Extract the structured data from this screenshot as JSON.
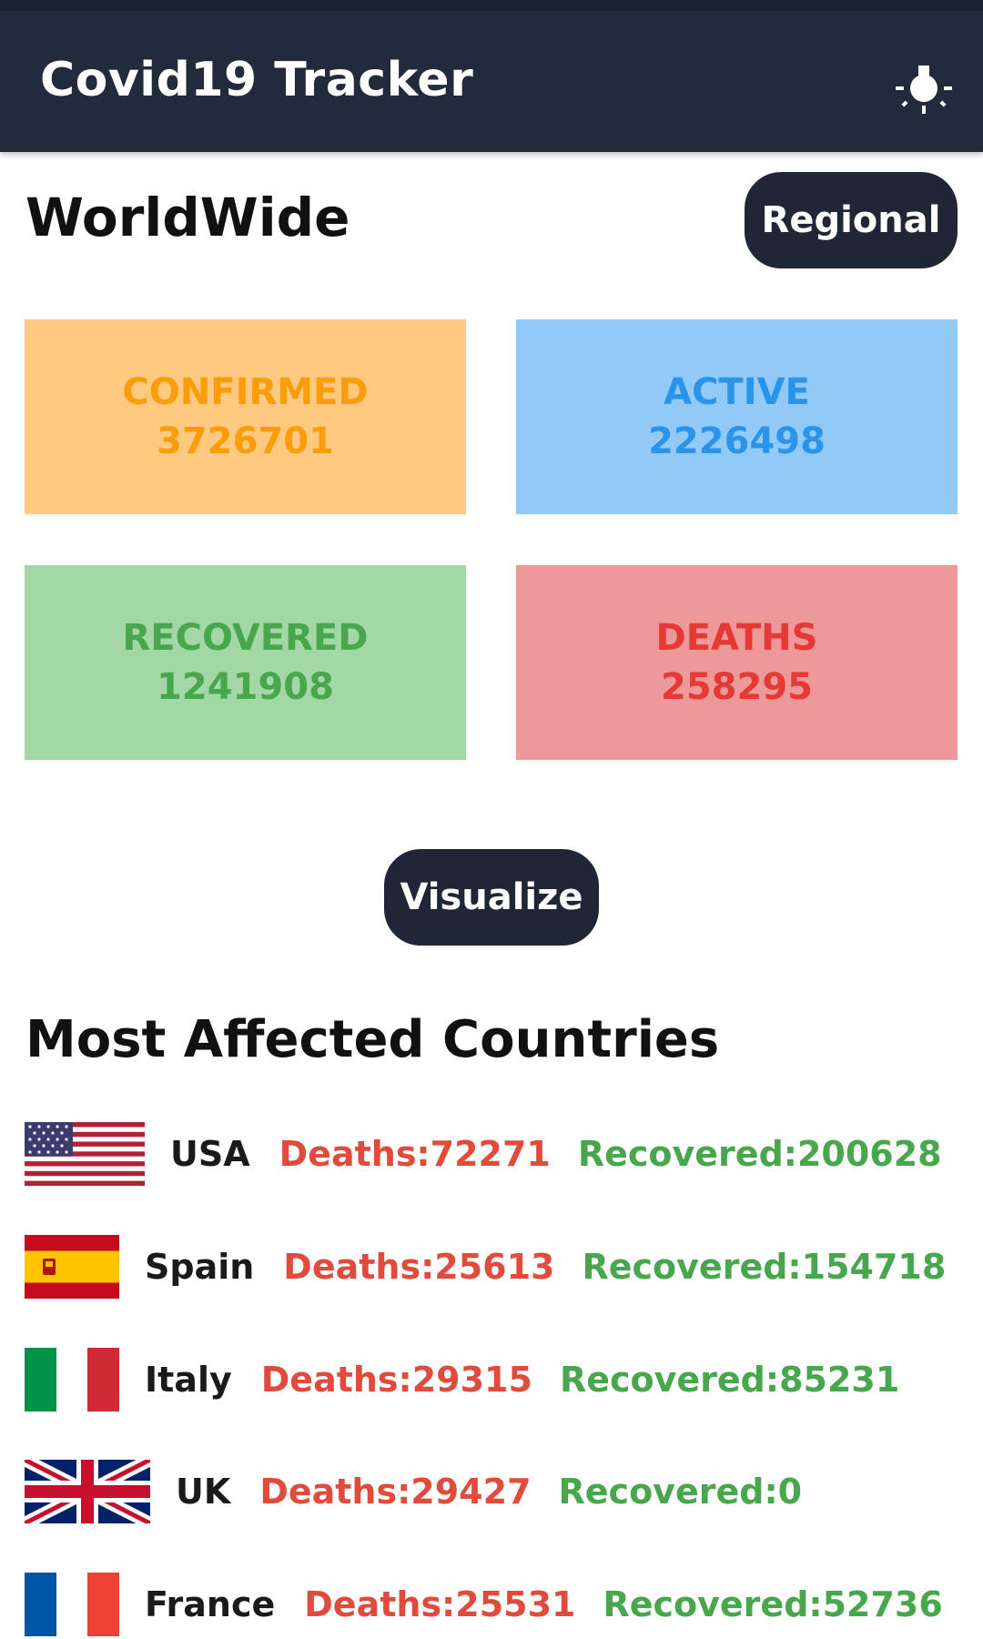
{
  "app": {
    "title": "Covid19 Tracker",
    "theme_icon": "lightbulb-icon"
  },
  "header": {
    "title": "WorldWide",
    "regional_label": "Regional"
  },
  "stats": {
    "confirmed": {
      "label": "CONFIRMED",
      "value": "3726701",
      "bg": "#ffca7f",
      "color": "#fb9d0b"
    },
    "active": {
      "label": "ACTIVE",
      "value": "2226498",
      "bg": "#91c9f7",
      "color": "#2994ea"
    },
    "recovered": {
      "label": "RECOVERED",
      "value": "1241908",
      "bg": "#a4d7a6",
      "color": "#48a74c"
    },
    "deaths": {
      "label": "DEATHS",
      "value": "258295",
      "bg": "#ee9999",
      "color": "#e53935"
    }
  },
  "visualize_label": "Visualize",
  "countries_title": "Most Affected Countries",
  "countries": [
    {
      "name": "USA",
      "deaths": "Deaths:72271",
      "recovered": "Recovered:200628",
      "flag": "usa-flag-icon"
    },
    {
      "name": "Spain",
      "deaths": "Deaths:25613",
      "recovered": "Recovered:154718",
      "flag": "spain-flag-icon"
    },
    {
      "name": "Italy",
      "deaths": "Deaths:29315",
      "recovered": "Recovered:85231",
      "flag": "italy-flag-icon"
    },
    {
      "name": "UK",
      "deaths": "Deaths:29427",
      "recovered": "Recovered:0",
      "flag": "uk-flag-icon"
    },
    {
      "name": "France",
      "deaths": "Deaths:25531",
      "recovered": "Recovered:52736",
      "flag": "france-flag-icon"
    }
  ]
}
